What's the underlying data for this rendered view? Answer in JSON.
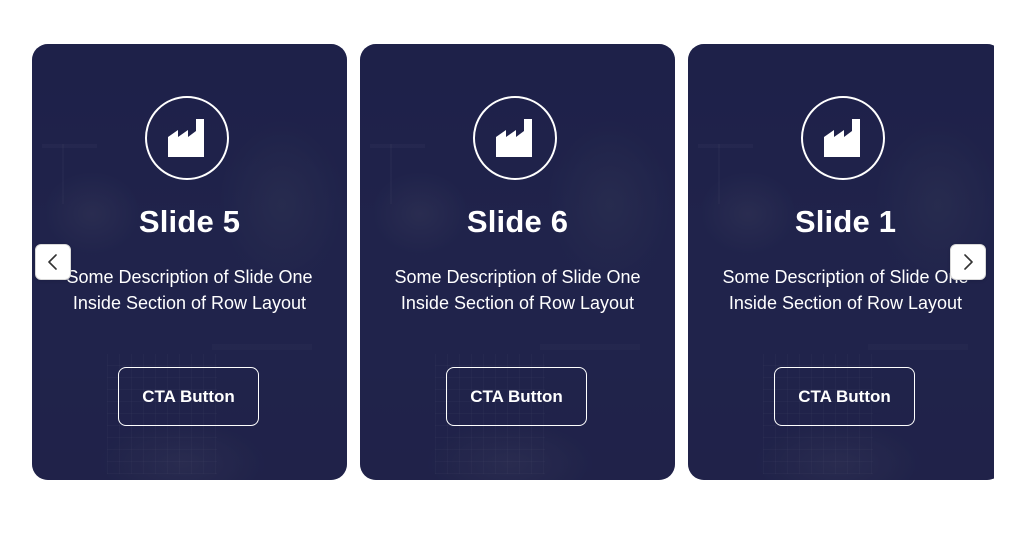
{
  "carousel": {
    "slides": [
      {
        "title": "Slide 5",
        "description": "Some Description of Slide One Inside Section of Row Layout",
        "cta_label": "CTA Button",
        "icon": "factory-icon"
      },
      {
        "title": "Slide 6",
        "description": "Some Description of Slide One Inside Section of Row Layout",
        "cta_label": "CTA Button",
        "icon": "factory-icon"
      },
      {
        "title": "Slide 1",
        "description": "Some Description of Slide One Inside Section of Row Layout",
        "cta_label": "CTA Button",
        "icon": "factory-icon"
      }
    ],
    "prev_icon": "chevron-left-icon",
    "next_icon": "chevron-right-icon"
  },
  "colors": {
    "slide_overlay": "#262a52",
    "text": "#ffffff",
    "arrow_background": "#ffffff"
  }
}
